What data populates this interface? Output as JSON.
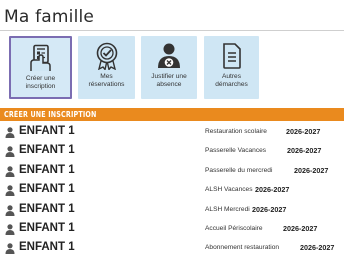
{
  "page": {
    "title": "Ma famille"
  },
  "actions": [
    {
      "label": "Créer une\ninscription",
      "icon": "form-hand-icon"
    },
    {
      "label": "Mes\nréservations",
      "icon": "badge-check-icon"
    },
    {
      "label": "Justifier une\nabsence",
      "icon": "user-remove-icon"
    },
    {
      "label": "Autres\ndémarches",
      "icon": "document-icon"
    }
  ],
  "section": {
    "title": "CRÉER UNE INSCRIPTION"
  },
  "registrations": [
    {
      "child": "ENFANT 1",
      "service": "Restauration scolaire",
      "year": "2026-2027"
    },
    {
      "child": "ENFANT 1",
      "service": "Passerelle Vacances",
      "year": "2026-2027"
    },
    {
      "child": "ENFANT 1",
      "service": "Passerelle du mercredi",
      "year": "2026-2027"
    },
    {
      "child": "ENFANT 1",
      "service": "ALSH Vacances",
      "year": "2026-2027"
    },
    {
      "child": "ENFANT 1",
      "service": "ALSH Mercredi",
      "year": "2026-2027"
    },
    {
      "child": "ENFANT 1",
      "service": "Accueil Périscolaire",
      "year": "2026-2027"
    },
    {
      "child": "ENFANT 1",
      "service": "Abonnement restauration",
      "year": "2026-2027"
    }
  ],
  "colors": {
    "accent": "#ea8a1e",
    "tile": "#cfe6f4",
    "selected_border": "#7b6db2"
  }
}
